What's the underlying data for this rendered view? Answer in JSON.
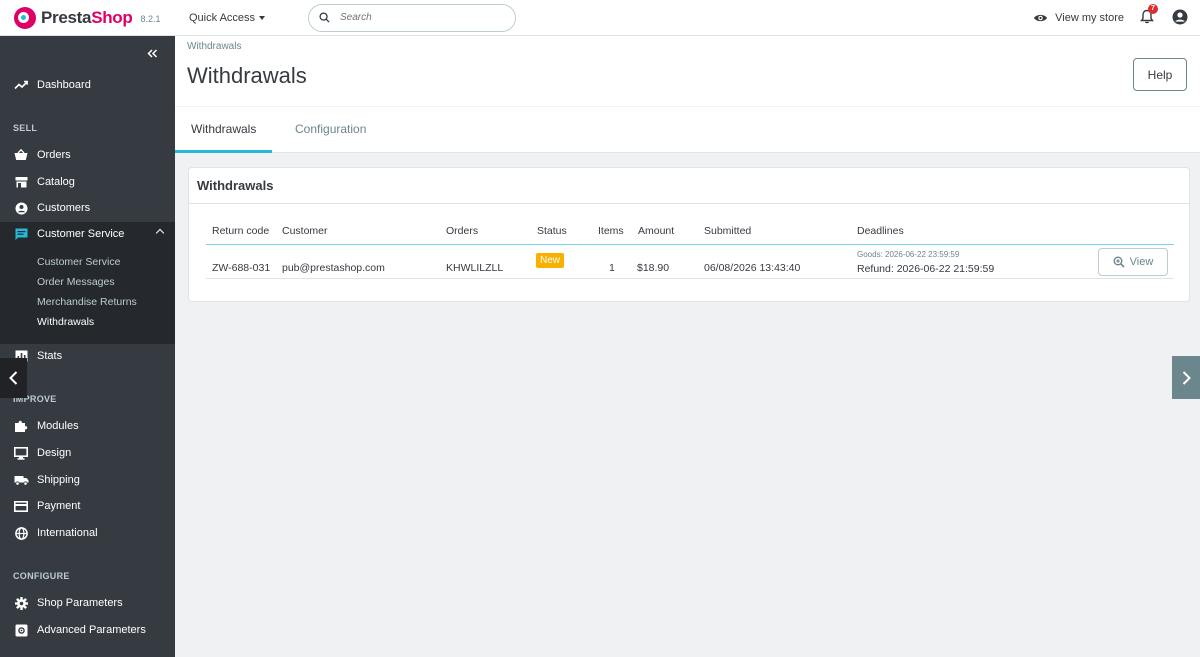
{
  "header": {
    "brand_prefix": "Presta",
    "brand_suffix": "Shop",
    "version": "8.2.1",
    "quick_access": "Quick Access",
    "search_placeholder": "Search",
    "view_store": "View my store",
    "notifications_count": "7"
  },
  "sidebar": {
    "dashboard": "Dashboard",
    "sections": {
      "sell": "SELL",
      "improve": "IMPROVE",
      "configure": "CONFIGURE"
    },
    "sell_items": {
      "orders": "Orders",
      "catalog": "Catalog",
      "customers": "Customers",
      "customer_service": "Customer Service"
    },
    "customer_service_submenu": [
      "Customer Service",
      "Order Messages",
      "Merchandise Returns",
      "Withdrawals"
    ],
    "stats": "Stats",
    "improve_items": {
      "modules": "Modules",
      "design": "Design",
      "shipping": "Shipping",
      "payment": "Payment",
      "international": "International"
    },
    "configure_items": {
      "shop_parameters": "Shop Parameters",
      "advanced_parameters": "Advanced Parameters"
    }
  },
  "page": {
    "breadcrumb": "Withdrawals",
    "title": "Withdrawals",
    "help": "Help"
  },
  "tabs": [
    "Withdrawals",
    "Configuration"
  ],
  "card": {
    "title": "Withdrawals",
    "columns": [
      "Return code",
      "Customer",
      "Orders",
      "Status",
      "Items",
      "Amount",
      "Submitted",
      "Deadlines"
    ],
    "rows": [
      {
        "return_code": "ZW-688-031",
        "customer": "pub@prestashop.com",
        "order": "KHWLILZLL",
        "status": "New",
        "items": "1",
        "amount": "$18.90",
        "submitted": "06/08/2026 13:43:40",
        "deadline_goods": "Goods: 2026-06-22 23:59:59",
        "deadline_refund": "Refund: 2026-06-22 21:59:59",
        "action": "View"
      }
    ]
  },
  "colors": {
    "accent": "#25b9d7",
    "brand": "#df0067",
    "status_new": "#fab000",
    "sidebar": "#363a41"
  }
}
